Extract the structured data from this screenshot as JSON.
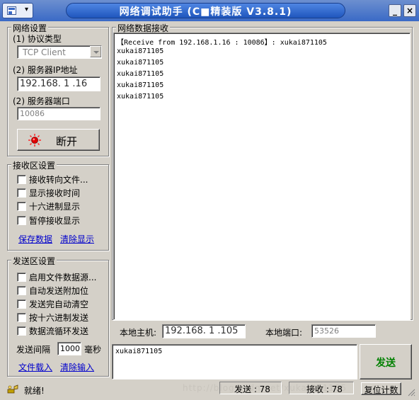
{
  "window": {
    "title": "网络调试助手 (C■精装版 V3.8.1)",
    "minimize_glyph": "_",
    "close_glyph": "×",
    "menu_arrow": "▾"
  },
  "network_settings": {
    "group_title": "网络设置",
    "protocol_label": "(1) 协议类型",
    "protocol_value": "TCP Client",
    "server_ip_label": "(2) 服务器IP地址",
    "server_ip_value": "192.168. 1 .16",
    "server_port_label": "(2) 服务器端口",
    "server_port_value": "10086",
    "disconnect_label": "断开"
  },
  "receive_settings": {
    "group_title": "接收区设置",
    "options": [
      {
        "label": "接收转向文件...",
        "checked": false
      },
      {
        "label": "显示接收时间",
        "checked": false
      },
      {
        "label": "十六进制显示",
        "checked": false
      },
      {
        "label": "暂停接收显示",
        "checked": false
      }
    ],
    "save_link": "保存数据",
    "clear_link": "清除显示"
  },
  "send_settings": {
    "group_title": "发送区设置",
    "options": [
      {
        "label": "启用文件数据源...",
        "checked": false
      },
      {
        "label": "自动发送附加位",
        "checked": false
      },
      {
        "label": "发送完自动清空",
        "checked": false
      },
      {
        "label": "按十六进制发送",
        "checked": false
      },
      {
        "label": "数据流循环发送",
        "checked": false
      }
    ],
    "interval_label": "发送间隔",
    "interval_value": "1000",
    "interval_unit": "毫秒",
    "load_file_link": "文件载入",
    "clear_input_link": "清除输入"
  },
  "receive_area": {
    "group_title": "网络数据接收",
    "lines": [
      "【Receive from 192.168.1.16 : 10086】: xukai871105",
      "xukai871105",
      "xukai871105",
      "xukai871105",
      "xukai871105",
      "xukai871105"
    ]
  },
  "local": {
    "host_label": "本地主机:",
    "host_value": "192.168. 1 .105",
    "port_label": "本地端口:",
    "port_value": "53526"
  },
  "send_area": {
    "text": "xukai871105",
    "send_button": "发送"
  },
  "status": {
    "ready_text": "就绪!",
    "sent_label": "发送 : 78",
    "received_label": "接收 : 78",
    "reset_label": "复位计数",
    "watermark": "http://blog.csdn.net/xukai871105"
  },
  "colors": {
    "title_blue": "#3a6ac6",
    "send_green": "#008000",
    "link_blue": "#0000cc"
  }
}
